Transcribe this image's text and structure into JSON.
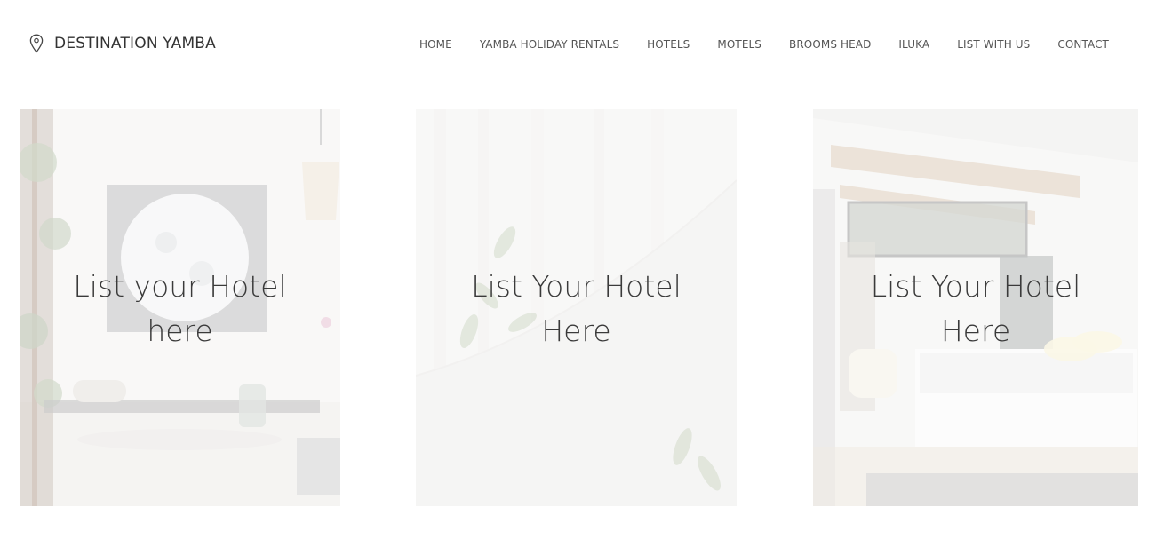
{
  "brand": {
    "name": "DESTINATION YAMBA",
    "icon": "map-pin-icon"
  },
  "nav": {
    "items": [
      "HOME",
      "YAMBA HOLIDAY RENTALS",
      "HOTELS",
      "MOTELS",
      "BROOMS HEAD",
      "ILUKA",
      "LIST WITH US",
      "CONTACT"
    ]
  },
  "cards": [
    {
      "caption_line1": "List your Hotel",
      "caption_line2": "here"
    },
    {
      "caption_line1": "List Your Hotel",
      "caption_line2": "Here"
    },
    {
      "caption_line1": "List Your Hotel",
      "caption_line2": "Here"
    }
  ]
}
